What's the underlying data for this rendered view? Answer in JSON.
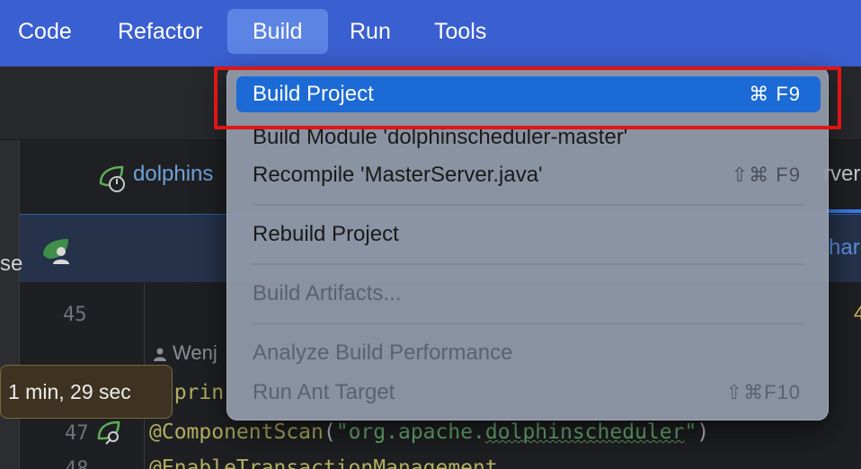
{
  "menubar": {
    "items": [
      {
        "label": "Code"
      },
      {
        "label": "Refactor"
      },
      {
        "label": "Build"
      },
      {
        "label": "Run"
      },
      {
        "label": "Tools"
      }
    ]
  },
  "editor_tabs": {
    "active_tab_title": "dolphins",
    "right_tab_fragment": "rver"
  },
  "banner": {
    "left_fragment": "se",
    "right_link_fragment": "har"
  },
  "editor": {
    "line_numbers": [
      "45",
      "47",
      "48"
    ],
    "author": "Wenj",
    "code_line_1_annotation": "@Sprin",
    "code_line_2_annotation": "@ComponentScan",
    "code_line_2_open": "(",
    "code_line_2_string_start": "\"org.apache.",
    "code_line_2_string_wavy": "dolphinscheduler",
    "code_line_2_string_end": "\"",
    "code_line_2_close": ")",
    "code_line_3_partial": "@EnableTransactionManagement",
    "right_marker": "4"
  },
  "tooltip": {
    "text": "1 min, 29 sec"
  },
  "build_menu": {
    "items": [
      {
        "label": "Build Project",
        "shortcut": "⌘ F9",
        "state": "highlighted"
      },
      {
        "label": "Build Module 'dolphinscheduler-master'",
        "shortcut": "",
        "state": "partially-hidden"
      },
      {
        "label": "Recompile 'MasterServer.java'",
        "shortcut": "⇧⌘ F9",
        "state": "enabled"
      },
      {
        "label": "Rebuild Project",
        "shortcut": "",
        "state": "enabled"
      },
      {
        "label": "Build Artifacts...",
        "shortcut": "",
        "state": "disabled"
      },
      {
        "label": "Analyze Build Performance",
        "shortcut": "",
        "state": "disabled"
      },
      {
        "label": "Run Ant Target",
        "shortcut": "⇧⌘F10",
        "state": "disabled"
      }
    ]
  },
  "colors": {
    "menubar_bg": "#3a5fd0",
    "menu_highlight": "#1c6ad6",
    "focus_box": "#e01515",
    "tooltip_bg": "#3d3320"
  }
}
